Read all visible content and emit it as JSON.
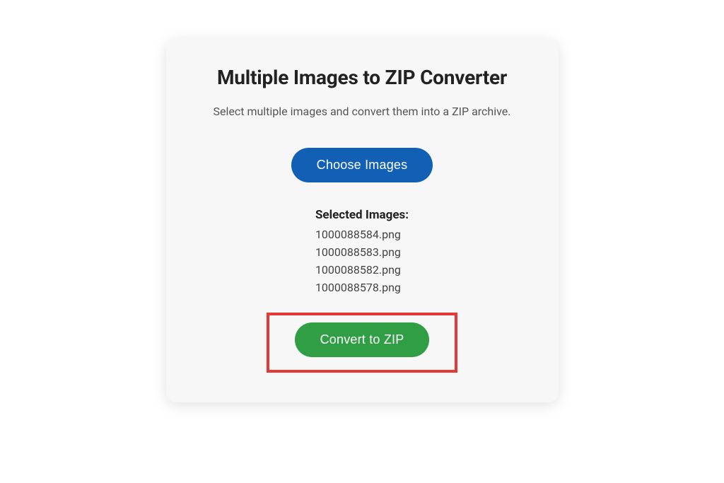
{
  "card": {
    "title": "Multiple Images to ZIP Converter",
    "subtitle": "Select multiple images and convert them into a ZIP archive.",
    "chooseButton": "Choose Images",
    "selectedLabel": "Selected Images:",
    "files": [
      "1000088584.png",
      "1000088583.png",
      "1000088582.png",
      "1000088578.png"
    ],
    "convertButton": "Convert to ZIP"
  }
}
